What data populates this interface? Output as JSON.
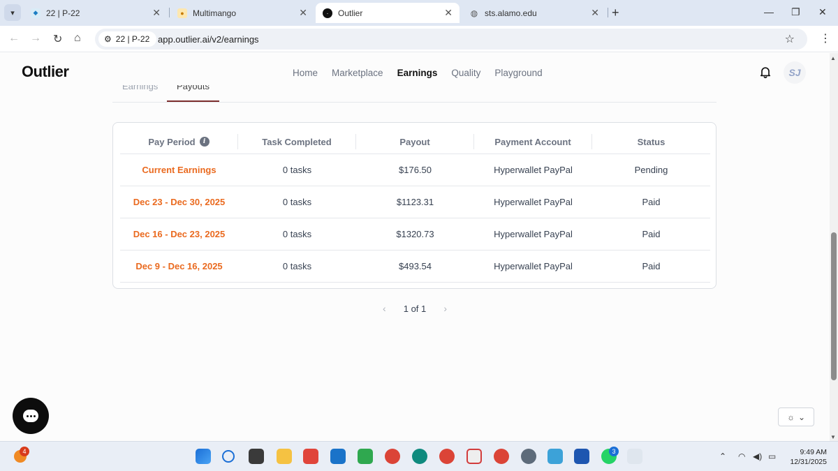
{
  "browser": {
    "tabs": [
      {
        "title": "22 | P-22",
        "active": false
      },
      {
        "title": "Multimango",
        "active": false
      },
      {
        "title": "Outlier",
        "active": true
      },
      {
        "title": "sts.alamo.edu",
        "active": false
      }
    ],
    "site_chip": "22 | P-22",
    "url": "app.outlier.ai/v2/earnings"
  },
  "header": {
    "logo": "Outlier",
    "nav": [
      "Home",
      "Marketplace",
      "Earnings",
      "Quality",
      "Playground"
    ],
    "active_nav": "Earnings",
    "avatar_initials": "SJ"
  },
  "subtabs": [
    "Earnings",
    "Payouts"
  ],
  "table": {
    "columns": [
      "Pay Period",
      "Task Completed",
      "Payout",
      "Payment Account",
      "Status"
    ],
    "rows": [
      {
        "period": "Current Earnings",
        "tasks": "0 tasks",
        "payout": "$176.50",
        "account": "Hyperwallet PayPal",
        "status": "Pending"
      },
      {
        "period": "Dec 23 - Dec 30, 2025",
        "tasks": "0 tasks",
        "payout": "$1123.31",
        "account": "Hyperwallet PayPal",
        "status": "Paid"
      },
      {
        "period": "Dec 16 - Dec 23, 2025",
        "tasks": "0 tasks",
        "payout": "$1320.73",
        "account": "Hyperwallet PayPal",
        "status": "Paid"
      },
      {
        "period": "Dec 9 - Dec 16, 2025",
        "tasks": "0 tasks",
        "payout": "$493.54",
        "account": "Hyperwallet PayPal",
        "status": "Paid"
      }
    ]
  },
  "pagination": {
    "label": "1 of 1"
  },
  "taskbar": {
    "weather_badge": "4",
    "whatsapp_badge": "3",
    "time": "9:49 AM",
    "date": "12/31/2025"
  },
  "colors": {
    "accent_orange": "#ea6a1f",
    "tab_underline": "#7c2d2d",
    "chrome_bg": "#dfe7f3"
  }
}
